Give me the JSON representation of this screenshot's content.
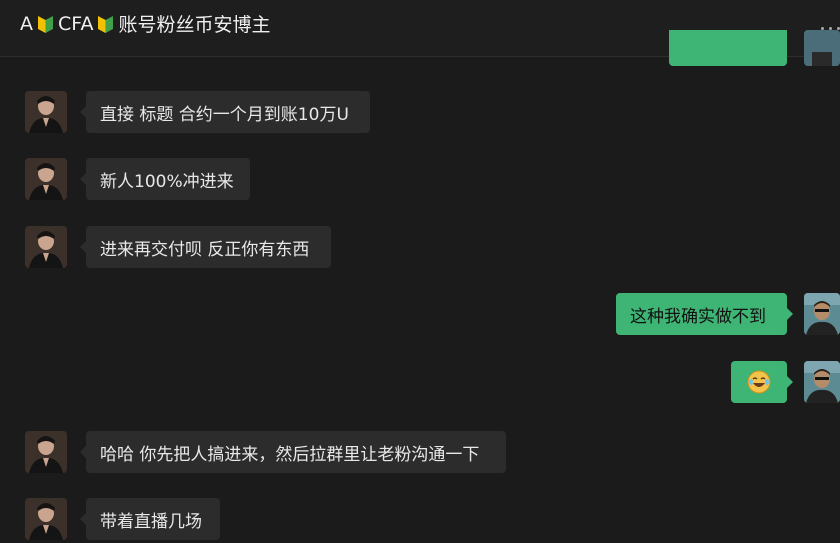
{
  "header": {
    "title_prefix": "A",
    "title_mid": "CFA",
    "title_suffix": "账号粉丝币安博主",
    "badge_icon": "beginner-mark-icon",
    "badge_colors": [
      "#f2c200",
      "#3fa14a"
    ]
  },
  "messages": [
    {
      "side": "in",
      "text": "直接 标题 合约一个月到账10万U"
    },
    {
      "side": "in",
      "text": "新人100%冲进来"
    },
    {
      "side": "in",
      "text": "进来再交付呗 反正你有东西"
    },
    {
      "side": "out",
      "text": "这种我确实做不到"
    },
    {
      "side": "out",
      "text": "",
      "emoji": "laughing-crying-emoji-icon"
    },
    {
      "side": "in",
      "text": "哈哈 你先把人搞进来，然后拉群里让老粉沟通一下"
    },
    {
      "side": "in",
      "text": "带着直播几场"
    }
  ],
  "colors": {
    "background": "#1b1b1b",
    "incoming_bubble": "#2c2c2c",
    "outgoing_bubble": "#3eb575"
  }
}
